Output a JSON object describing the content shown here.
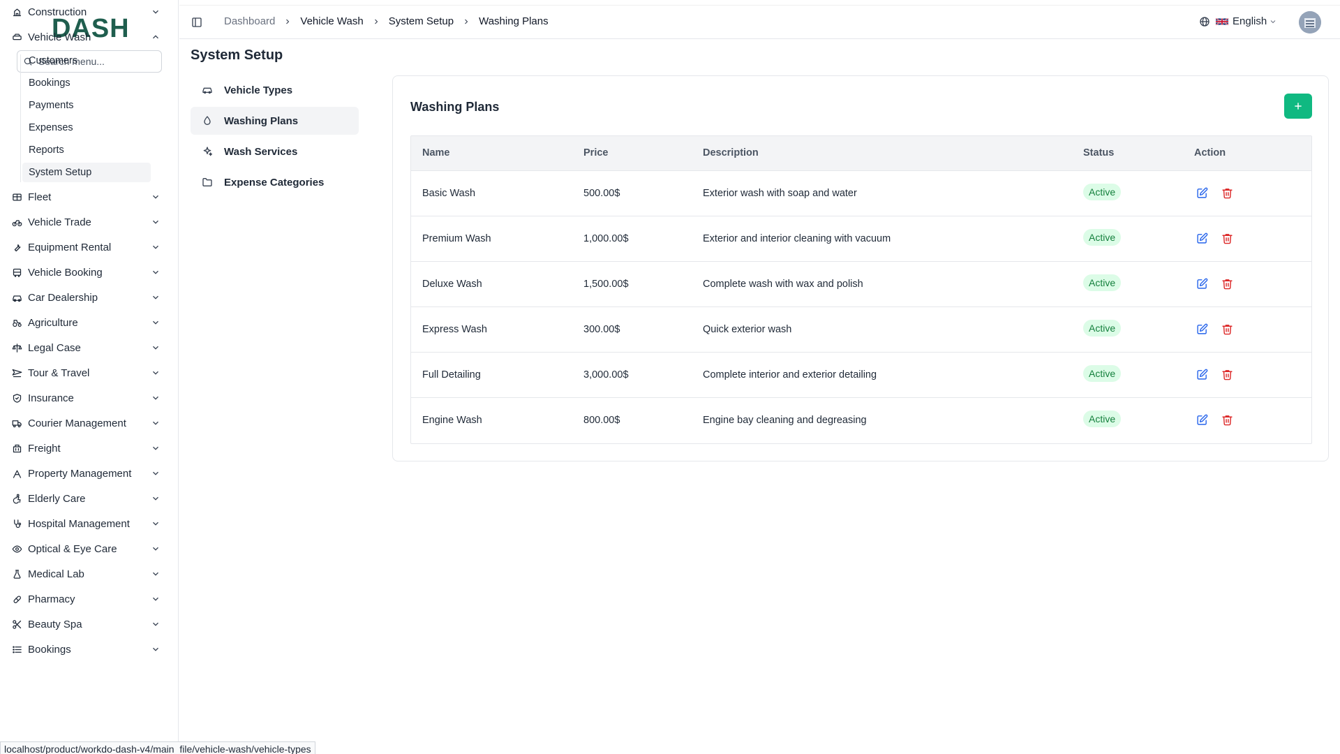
{
  "brand": {
    "logo_text": "DASH",
    "accent": "#10b981"
  },
  "search": {
    "placeholder": "Search menu..."
  },
  "sidebar": {
    "items": [
      {
        "label": "Construction",
        "icon": "construction-icon"
      },
      {
        "label": "Vehicle Wash",
        "icon": "car-wash-icon",
        "expanded": true
      },
      {
        "label": "Fleet",
        "icon": "fleet-icon"
      },
      {
        "label": "Vehicle Trade",
        "icon": "bike-icon"
      },
      {
        "label": "Equipment Rental",
        "icon": "wrench-icon"
      },
      {
        "label": "Vehicle Booking",
        "icon": "bus-icon"
      },
      {
        "label": "Car Dealership",
        "icon": "car-icon"
      },
      {
        "label": "Agriculture",
        "icon": "tractor-icon"
      },
      {
        "label": "Legal Case",
        "icon": "scale-icon"
      },
      {
        "label": "Tour & Travel",
        "icon": "plane-icon"
      },
      {
        "label": "Insurance",
        "icon": "shield-icon"
      },
      {
        "label": "Courier Management",
        "icon": "truck-icon"
      },
      {
        "label": "Freight",
        "icon": "container-icon"
      },
      {
        "label": "Property Management",
        "icon": "building-icon"
      },
      {
        "label": "Elderly Care",
        "icon": "accessibility-icon"
      },
      {
        "label": "Hospital Management",
        "icon": "stethoscope-icon"
      },
      {
        "label": "Optical & Eye Care",
        "icon": "eye-icon"
      },
      {
        "label": "Medical Lab",
        "icon": "flask-icon"
      },
      {
        "label": "Pharmacy",
        "icon": "pill-icon"
      },
      {
        "label": "Beauty Spa",
        "icon": "scissors-icon"
      },
      {
        "label": "Bookings",
        "icon": "list-icon"
      }
    ],
    "sub_items": [
      "Customers",
      "Bookings",
      "Payments",
      "Expenses",
      "Reports",
      "System Setup"
    ]
  },
  "header": {
    "breadcrumb": [
      "Dashboard",
      "Vehicle Wash",
      "System Setup",
      "Washing Plans"
    ],
    "language": "English"
  },
  "page": {
    "title": "System Setup"
  },
  "setup_nav": [
    {
      "label": "Vehicle Types",
      "icon": "car-icon"
    },
    {
      "label": "Washing Plans",
      "icon": "droplet-icon",
      "active": true
    },
    {
      "label": "Wash Services",
      "icon": "sparkles-icon"
    },
    {
      "label": "Expense Categories",
      "icon": "folder-icon"
    }
  ],
  "card": {
    "title": "Washing Plans",
    "add_label": "+",
    "columns": [
      "Name",
      "Price",
      "Description",
      "Status",
      "Action"
    ],
    "rows": [
      {
        "name": "Basic Wash",
        "price": "500.00$",
        "description": "Exterior wash with soap and water",
        "status": "Active"
      },
      {
        "name": "Premium Wash",
        "price": "1,000.00$",
        "description": "Exterior and interior cleaning with vacuum",
        "status": "Active"
      },
      {
        "name": "Deluxe Wash",
        "price": "1,500.00$",
        "description": "Complete wash with wax and polish",
        "status": "Active"
      },
      {
        "name": "Express Wash",
        "price": "300.00$",
        "description": "Quick exterior wash",
        "status": "Active"
      },
      {
        "name": "Full Detailing",
        "price": "3,000.00$",
        "description": "Complete interior and exterior detailing",
        "status": "Active"
      },
      {
        "name": "Engine Wash",
        "price": "800.00$",
        "description": "Engine bay cleaning and degreasing",
        "status": "Active"
      }
    ]
  },
  "status_bar": {
    "url": "localhost/product/workdo-dash-v4/main_file/vehicle-wash/vehicle-types"
  }
}
